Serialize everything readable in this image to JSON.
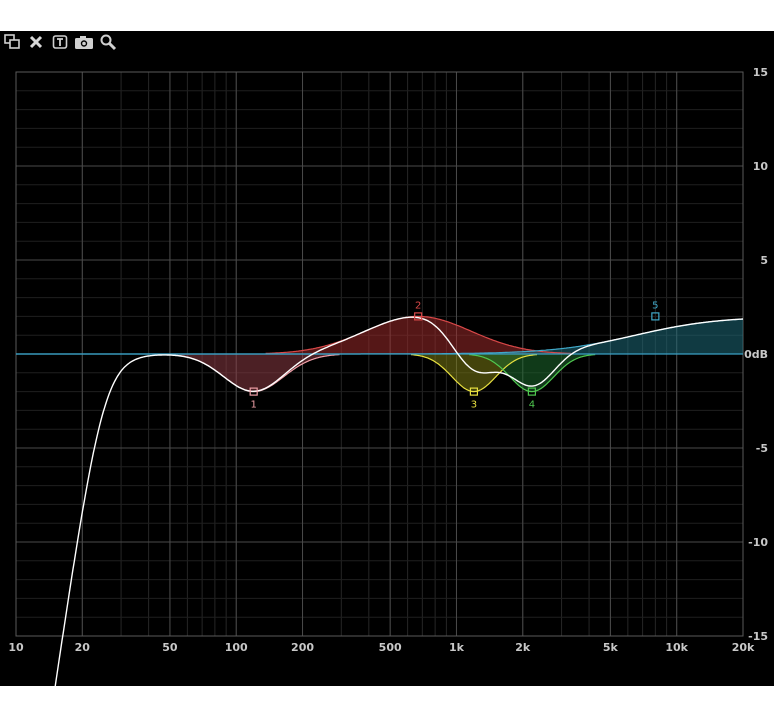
{
  "toolbar": {
    "buttons": [
      {
        "name": "resize-icon"
      },
      {
        "name": "close-icon"
      },
      {
        "name": "text-icon"
      },
      {
        "name": "camera-icon"
      },
      {
        "name": "zoom-icon"
      }
    ]
  },
  "chart_data": {
    "type": "line",
    "title": "",
    "xlabel": "",
    "ylabel": "",
    "x_scale": "log",
    "xlim": [
      10,
      20000
    ],
    "ylim": [
      -15,
      15
    ],
    "grid": true,
    "x_ticks": [
      {
        "value": 10,
        "label": "10"
      },
      {
        "value": 20,
        "label": "20"
      },
      {
        "value": 50,
        "label": "50"
      },
      {
        "value": 100,
        "label": "100"
      },
      {
        "value": 200,
        "label": "200"
      },
      {
        "value": 500,
        "label": "500"
      },
      {
        "value": 1000,
        "label": "1k"
      },
      {
        "value": 2000,
        "label": "2k"
      },
      {
        "value": 5000,
        "label": "5k"
      },
      {
        "value": 10000,
        "label": "10k"
      },
      {
        "value": 20000,
        "label": "20k"
      }
    ],
    "y_ticks": [
      {
        "value": 15,
        "label": "15"
      },
      {
        "value": 10,
        "label": "10"
      },
      {
        "value": 5,
        "label": "5"
      },
      {
        "value": 0,
        "label": "0dB"
      },
      {
        "value": -5,
        "label": "-5"
      },
      {
        "value": -10,
        "label": "-10"
      },
      {
        "value": -15,
        "label": "-15"
      }
    ],
    "bands": [
      {
        "label": "1",
        "type": "bell",
        "freq": 120,
        "gain": -2,
        "width_oct": 0.45,
        "color": "#f0a0a8",
        "fill": "#8a3a44"
      },
      {
        "label": "2",
        "type": "bell",
        "freq": 670,
        "gain": 2,
        "width_oct": 0.8,
        "color": "#d84848",
        "fill": "#9a2a2a"
      },
      {
        "label": "3",
        "type": "bell",
        "freq": 1200,
        "gain": -2,
        "width_oct": 0.33,
        "color": "#e8e040",
        "fill": "#7a7a14"
      },
      {
        "label": "4",
        "type": "bell",
        "freq": 2200,
        "gain": -2,
        "width_oct": 0.33,
        "color": "#50c850",
        "fill": "#1e6a2e"
      },
      {
        "label": "5",
        "type": "shelf",
        "freq": 8000,
        "gain": 2,
        "color": "#40a8c8",
        "fill": "#1e6a78"
      }
    ],
    "highpass": {
      "freq": 25,
      "order": 4
    },
    "series": [
      {
        "color": "#ffffff"
      }
    ]
  }
}
